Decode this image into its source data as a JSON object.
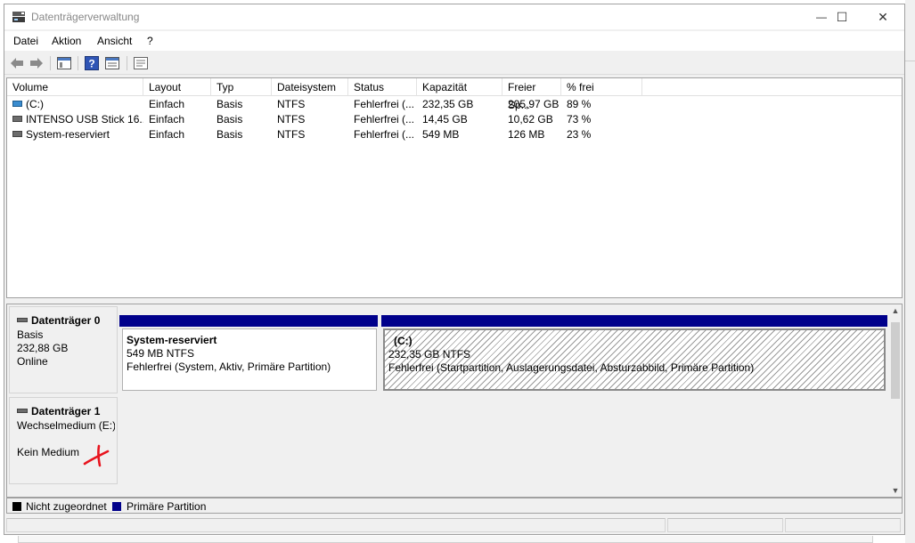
{
  "window": {
    "title": "Datenträgerverwaltung",
    "minimize_glyph": "—",
    "maximize_glyph": "☐",
    "close_glyph": "✕"
  },
  "menu": {
    "items": [
      "Datei",
      "Aktion",
      "Ansicht",
      "?"
    ]
  },
  "toolbar": {
    "icons": [
      "back-arrow-icon",
      "forward-arrow-icon",
      "console-tree-icon",
      "help-icon",
      "properties-icon",
      "settings-list-icon"
    ]
  },
  "volume_list": {
    "columns": [
      "Volume",
      "Layout",
      "Typ",
      "Dateisystem",
      "Status",
      "Kapazität",
      "Freier Sp...",
      "% frei"
    ],
    "rows": [
      {
        "volume": "(C:)",
        "icon": "system-drive-icon",
        "layout": "Einfach",
        "typ": "Basis",
        "dateisystem": "NTFS",
        "status": "Fehlerfrei (...",
        "kapazitaet": "232,35 GB",
        "freier_speicher": "205,97 GB",
        "prozent_frei": "89 %"
      },
      {
        "volume": "INTENSO USB Stick 16...",
        "icon": "drive-icon",
        "layout": "Einfach",
        "typ": "Basis",
        "dateisystem": "NTFS",
        "status": "Fehlerfrei (...",
        "kapazitaet": "14,45 GB",
        "freier_speicher": "10,62 GB",
        "prozent_frei": "73 %"
      },
      {
        "volume": "System-reserviert",
        "icon": "drive-icon",
        "layout": "Einfach",
        "typ": "Basis",
        "dateisystem": "NTFS",
        "status": "Fehlerfrei (...",
        "kapazitaet": "549 MB",
        "freier_speicher": "126 MB",
        "prozent_frei": "23 %"
      }
    ]
  },
  "disks": [
    {
      "name": "Datenträger 0",
      "type": "Basis",
      "size": "232,88 GB",
      "state": "Online",
      "partitions": [
        {
          "title": "System-reserviert",
          "size_fs": "549 MB NTFS",
          "status": "Fehlerfrei (System, Aktiv, Primäre Partition)"
        },
        {
          "title": "(C:)",
          "size_fs": "232,35 GB NTFS",
          "status": "Fehlerfrei (Startpartition, Auslagerungsdatei, Absturzabbild, Primäre Partition)"
        }
      ]
    },
    {
      "name": "Datenträger 1",
      "type": "Wechselmedium (E:)",
      "state": "Kein Medium"
    }
  ],
  "legend": {
    "items": [
      {
        "label": "Nicht zugeordnet",
        "color": "#000000"
      },
      {
        "label": "Primäre Partition",
        "color": "#00008b"
      }
    ]
  },
  "colors": {
    "partition_bar": "#00008b",
    "annotation": "#e8141e"
  }
}
